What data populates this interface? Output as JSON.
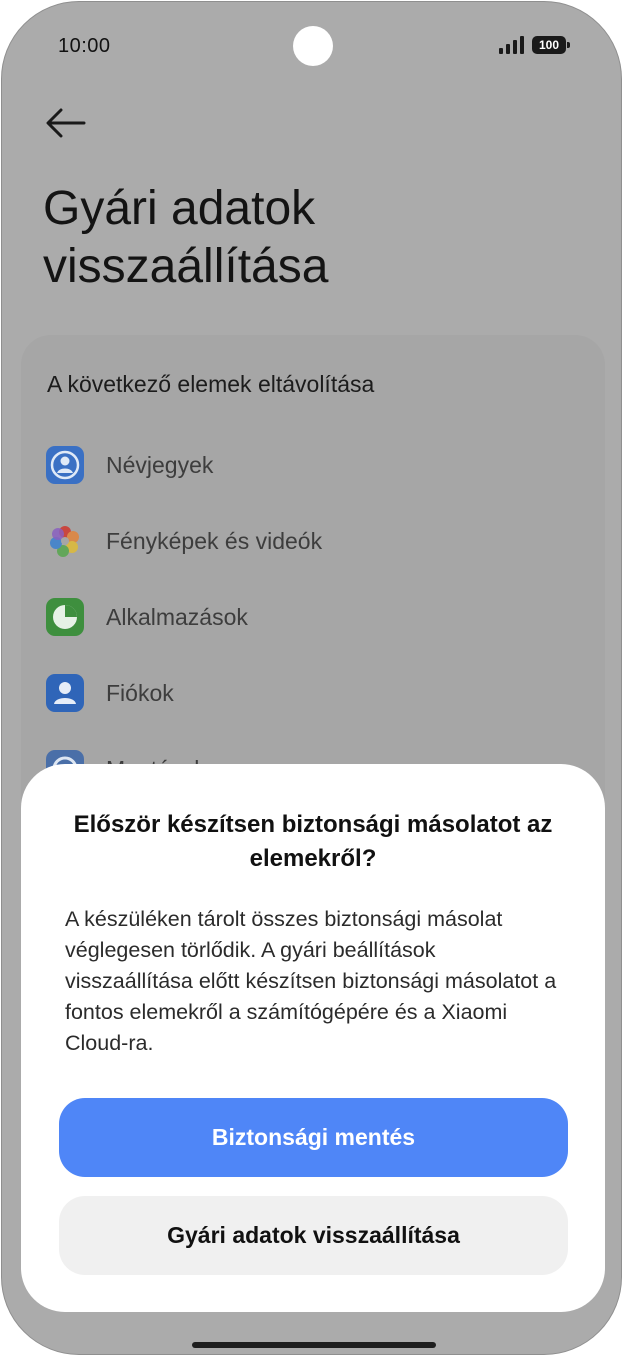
{
  "status_bar": {
    "time": "10:00",
    "battery": "100"
  },
  "page": {
    "title": "Gyári adatok visszaállítása",
    "section_heading": "A következő elemek eltávolítása",
    "items": [
      {
        "label": "Névjegyek",
        "icon": "contacts-icon"
      },
      {
        "label": "Fényképek és videók",
        "icon": "gallery-icon"
      },
      {
        "label": "Alkalmazások",
        "icon": "apps-icon"
      },
      {
        "label": "Fiókok",
        "icon": "accounts-icon"
      },
      {
        "label": "Mentések",
        "icon": "backup-icon"
      }
    ]
  },
  "dialog": {
    "title": "Először készítsen biztonsági másolatot az elemekről?",
    "body": "A készüléken tárolt összes biztonsági másolat véglegesen törlődik. A gyári beállítások visszaállítása előtt készítsen biztonsági másolatot a fontos elemekről a számítógépére és a Xiaomi Cloud-ra.",
    "primary_button": "Biztonsági mentés",
    "secondary_button": "Gyári adatok visszaállítása"
  },
  "colors": {
    "primary_button": "#4f86f7",
    "secondary_button": "#f0f0f0",
    "scrim": "#ababab"
  }
}
